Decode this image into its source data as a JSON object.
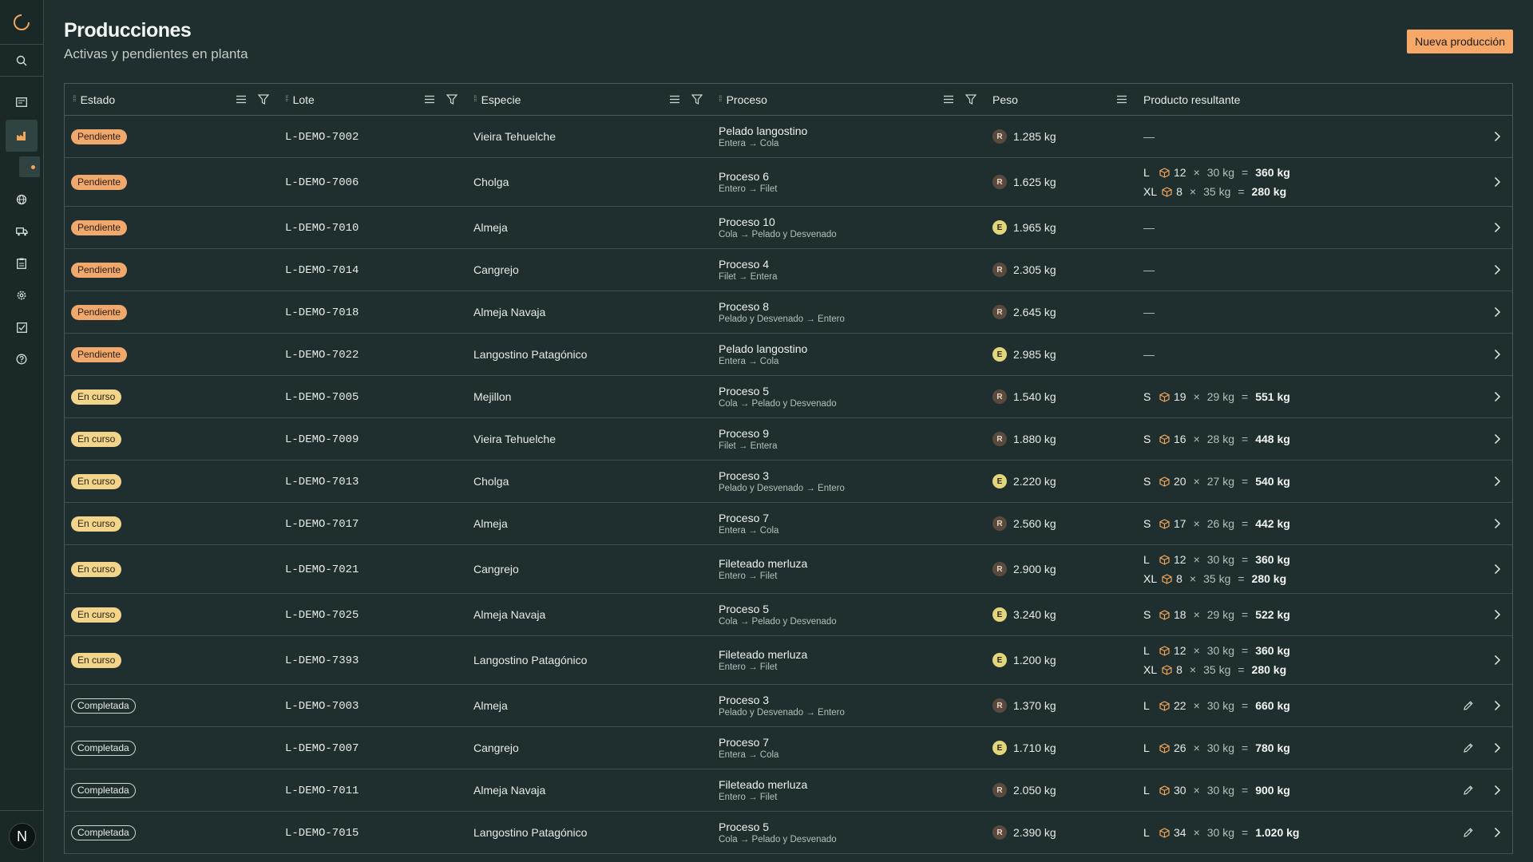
{
  "header": {
    "title": "Producciones",
    "subtitle": "Activas y pendientes en planta",
    "new_button": "Nueva producción"
  },
  "user": {
    "initial": "N"
  },
  "columns": {
    "estado": "Estado",
    "lote": "Lote",
    "especie": "Especie",
    "proceso": "Proceso",
    "peso": "Peso",
    "producto": "Producto resultante"
  },
  "rows": [
    {
      "estado": "Pendiente",
      "status": "pend",
      "lote": "L-DEMO-7002",
      "especie": "Vieira Tehuelche",
      "proceso": "Pelado langostino",
      "flujo": "Entera → Cola",
      "tipo": "R",
      "peso": "1.285 kg",
      "producto": [],
      "empty": "—",
      "edit": false
    },
    {
      "estado": "Pendiente",
      "status": "pend",
      "lote": "L-DEMO-7006",
      "especie": "Cholga",
      "proceso": "Proceso 6",
      "flujo": "Entero → Filet",
      "tipo": "R",
      "peso": "1.625 kg",
      "producto": [
        {
          "size": "L",
          "qty": "12",
          "unit": "30 kg",
          "total": "360 kg"
        },
        {
          "size": "XL",
          "qty": "8",
          "unit": "35 kg",
          "total": "280 kg"
        }
      ],
      "edit": false
    },
    {
      "estado": "Pendiente",
      "status": "pend",
      "lote": "L-DEMO-7010",
      "especie": "Almeja",
      "proceso": "Proceso 10",
      "flujo": "Cola → Pelado y Desvenado",
      "tipo": "E",
      "peso": "1.965 kg",
      "producto": [],
      "empty": "—",
      "edit": false
    },
    {
      "estado": "Pendiente",
      "status": "pend",
      "lote": "L-DEMO-7014",
      "especie": "Cangrejo",
      "proceso": "Proceso 4",
      "flujo": "Filet → Entera",
      "tipo": "R",
      "peso": "2.305 kg",
      "producto": [],
      "empty": "—",
      "edit": false
    },
    {
      "estado": "Pendiente",
      "status": "pend",
      "lote": "L-DEMO-7018",
      "especie": "Almeja Navaja",
      "proceso": "Proceso 8",
      "flujo": "Pelado y Desvenado → Entero",
      "tipo": "R",
      "peso": "2.645 kg",
      "producto": [],
      "empty": "—",
      "edit": false
    },
    {
      "estado": "Pendiente",
      "status": "pend",
      "lote": "L-DEMO-7022",
      "especie": "Langostino Patagónico",
      "proceso": "Pelado langostino",
      "flujo": "Entera → Cola",
      "tipo": "E",
      "peso": "2.985 kg",
      "producto": [],
      "empty": "—",
      "edit": false
    },
    {
      "estado": "En curso",
      "status": "curso",
      "lote": "L-DEMO-7005",
      "especie": "Mejillon",
      "proceso": "Proceso 5",
      "flujo": "Cola → Pelado y Desvenado",
      "tipo": "R",
      "peso": "1.540 kg",
      "producto": [
        {
          "size": "S",
          "qty": "19",
          "unit": "29 kg",
          "total": "551 kg"
        }
      ],
      "edit": false
    },
    {
      "estado": "En curso",
      "status": "curso",
      "lote": "L-DEMO-7009",
      "especie": "Vieira Tehuelche",
      "proceso": "Proceso 9",
      "flujo": "Filet → Entera",
      "tipo": "R",
      "peso": "1.880 kg",
      "producto": [
        {
          "size": "S",
          "qty": "16",
          "unit": "28 kg",
          "total": "448 kg"
        }
      ],
      "edit": false
    },
    {
      "estado": "En curso",
      "status": "curso",
      "lote": "L-DEMO-7013",
      "especie": "Cholga",
      "proceso": "Proceso 3",
      "flujo": "Pelado y Desvenado → Entero",
      "tipo": "E",
      "peso": "2.220 kg",
      "producto": [
        {
          "size": "S",
          "qty": "20",
          "unit": "27 kg",
          "total": "540 kg"
        }
      ],
      "edit": false
    },
    {
      "estado": "En curso",
      "status": "curso",
      "lote": "L-DEMO-7017",
      "especie": "Almeja",
      "proceso": "Proceso 7",
      "flujo": "Entera → Cola",
      "tipo": "R",
      "peso": "2.560 kg",
      "producto": [
        {
          "size": "S",
          "qty": "17",
          "unit": "26 kg",
          "total": "442 kg"
        }
      ],
      "edit": false
    },
    {
      "estado": "En curso",
      "status": "curso",
      "lote": "L-DEMO-7021",
      "especie": "Cangrejo",
      "proceso": "Fileteado merluza",
      "flujo": "Entero → Filet",
      "tipo": "R",
      "peso": "2.900 kg",
      "producto": [
        {
          "size": "L",
          "qty": "12",
          "unit": "30 kg",
          "total": "360 kg"
        },
        {
          "size": "XL",
          "qty": "8",
          "unit": "35 kg",
          "total": "280 kg"
        }
      ],
      "edit": false
    },
    {
      "estado": "En curso",
      "status": "curso",
      "lote": "L-DEMO-7025",
      "especie": "Almeja Navaja",
      "proceso": "Proceso 5",
      "flujo": "Cola → Pelado y Desvenado",
      "tipo": "E",
      "peso": "3.240 kg",
      "producto": [
        {
          "size": "S",
          "qty": "18",
          "unit": "29 kg",
          "total": "522 kg"
        }
      ],
      "edit": false
    },
    {
      "estado": "En curso",
      "status": "curso",
      "lote": "L-DEMO-7393",
      "especie": "Langostino Patagónico",
      "proceso": "Fileteado merluza",
      "flujo": "Entero → Filet",
      "tipo": "E",
      "peso": "1.200 kg",
      "producto": [
        {
          "size": "L",
          "qty": "12",
          "unit": "30 kg",
          "total": "360 kg"
        },
        {
          "size": "XL",
          "qty": "8",
          "unit": "35 kg",
          "total": "280 kg"
        }
      ],
      "edit": false
    },
    {
      "estado": "Completada",
      "status": "comp",
      "lote": "L-DEMO-7003",
      "especie": "Almeja",
      "proceso": "Proceso 3",
      "flujo": "Pelado y Desvenado → Entero",
      "tipo": "R",
      "peso": "1.370 kg",
      "producto": [
        {
          "size": "L",
          "qty": "22",
          "unit": "30 kg",
          "total": "660 kg"
        }
      ],
      "edit": true
    },
    {
      "estado": "Completada",
      "status": "comp",
      "lote": "L-DEMO-7007",
      "especie": "Cangrejo",
      "proceso": "Proceso 7",
      "flujo": "Entera → Cola",
      "tipo": "E",
      "peso": "1.710 kg",
      "producto": [
        {
          "size": "L",
          "qty": "26",
          "unit": "30 kg",
          "total": "780 kg"
        }
      ],
      "edit": true
    },
    {
      "estado": "Completada",
      "status": "comp",
      "lote": "L-DEMO-7011",
      "especie": "Almeja Navaja",
      "proceso": "Fileteado merluza",
      "flujo": "Entero → Filet",
      "tipo": "R",
      "peso": "2.050 kg",
      "producto": [
        {
          "size": "L",
          "qty": "30",
          "unit": "30 kg",
          "total": "900 kg"
        }
      ],
      "edit": true
    },
    {
      "estado": "Completada",
      "status": "comp",
      "lote": "L-DEMO-7015",
      "especie": "Langostino Patagónico",
      "proceso": "Proceso 5",
      "flujo": "Cola → Pelado y Desvenado",
      "tipo": "R",
      "peso": "2.390 kg",
      "producto": [
        {
          "size": "L",
          "qty": "34",
          "unit": "30 kg",
          "total": "1.020 kg"
        }
      ],
      "edit": true
    }
  ],
  "colors": {
    "background": "#1f2e2e",
    "accent": "#f5a868",
    "pending": "#f0a86c",
    "in_progress": "#f2d48a"
  },
  "icons": [
    "spinner-logo-icon",
    "search-icon",
    "dashboard-icon",
    "factory-icon",
    "globe-icon",
    "truck-icon",
    "clipboard-icon",
    "gear-icon",
    "checklist-icon",
    "help-icon",
    "box-icon",
    "chevron-right-icon",
    "pencil-icon",
    "menu-icon",
    "filter-icon",
    "grip-icon"
  ]
}
